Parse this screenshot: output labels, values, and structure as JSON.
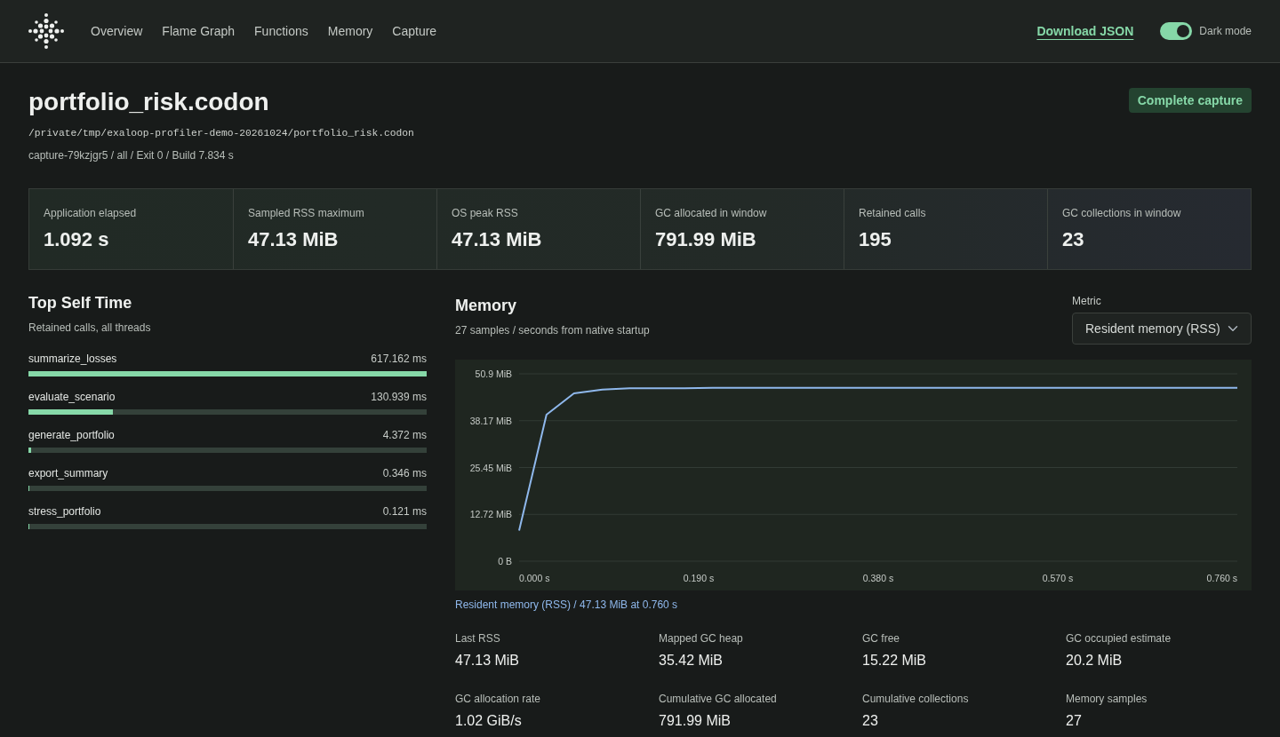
{
  "header": {
    "nav": [
      "Overview",
      "Flame Graph",
      "Functions",
      "Memory",
      "Capture"
    ],
    "download": "Download JSON",
    "dark_mode": {
      "label": "Dark mode",
      "on": true
    }
  },
  "page": {
    "title": "portfolio_risk.codon",
    "path": "/private/tmp/exaloop-profiler-demo-20261024/portfolio_risk.codon",
    "meta": "capture-79kzjgr5 / all / Exit 0 / Build 7.834 s",
    "status": "Complete capture"
  },
  "summary": [
    {
      "label": "Application elapsed",
      "value": "1.092 s"
    },
    {
      "label": "Sampled RSS maximum",
      "value": "47.13 MiB"
    },
    {
      "label": "OS peak RSS",
      "value": "47.13 MiB"
    },
    {
      "label": "GC allocated in window",
      "value": "791.99 MiB"
    },
    {
      "label": "Retained calls",
      "value": "195"
    },
    {
      "label": "GC collections in window",
      "value": "23"
    }
  ],
  "top_self_time": {
    "title": "Top Self Time",
    "subtitle": "Retained calls, all threads",
    "items": [
      {
        "name": "summarize_losses",
        "time": "617.162 ms",
        "level": 1
      },
      {
        "name": "evaluate_scenario",
        "time": "130.939 ms",
        "level": 0.212
      },
      {
        "name": "generate_portfolio",
        "time": "4.372 ms",
        "level": 0.007
      },
      {
        "name": "export_summary",
        "time": "0.346 ms",
        "level": 0.0006
      },
      {
        "name": "stress_portfolio",
        "time": "0.121 ms",
        "level": 0.0002
      }
    ]
  },
  "memory": {
    "title": "Memory",
    "subtitle": "27 samples / seconds from native startup",
    "metric": {
      "label": "Metric",
      "value": "Resident memory (RSS)"
    },
    "chart_data": {
      "type": "line",
      "grid": true,
      "x": [
        0,
        0.029,
        0.058,
        0.088,
        0.117,
        0.146,
        0.175,
        0.205,
        0.234,
        0.263,
        0.292,
        0.322,
        0.351,
        0.38,
        0.409,
        0.438,
        0.468,
        0.497,
        0.526,
        0.555,
        0.585,
        0.614,
        0.643,
        0.672,
        0.702,
        0.731,
        0.76
      ],
      "series": [
        {
          "color": "#8fb8ec",
          "values": [
            8.3,
            39.8,
            45.6,
            46.6,
            47.0,
            47.0,
            47.0,
            47.1,
            47.1,
            47.1,
            47.1,
            47.1,
            47.1,
            47.1,
            47.1,
            47.1,
            47.1,
            47.1,
            47.1,
            47.1,
            47.1,
            47.1,
            47.1,
            47.1,
            47.1,
            47.1,
            47.1
          ]
        }
      ],
      "xlim": [
        0,
        0.76
      ],
      "ylim": [
        0,
        50.9
      ],
      "xticks": [
        {
          "value": 0,
          "label": "0.000 s"
        },
        {
          "value": 0.19,
          "label": "0.190 s"
        },
        {
          "value": 0.38,
          "label": "0.380 s"
        },
        {
          "value": 0.57,
          "label": "0.570 s"
        },
        {
          "value": 0.76,
          "label": "0.760 s"
        }
      ],
      "yticks": [
        {
          "value": 0,
          "label": "0 B"
        },
        {
          "value": 12.72,
          "label": "12.72 MiB"
        },
        {
          "value": 25.45,
          "label": "25.45 MiB"
        },
        {
          "value": 38.17,
          "label": "38.17 MiB"
        },
        {
          "value": 50.9,
          "label": "50.9 MiB"
        }
      ]
    },
    "caption": "Resident memory (RSS) / 47.13 MiB at 0.760 s",
    "stats": [
      {
        "label": "Last RSS",
        "value": "47.13 MiB"
      },
      {
        "label": "Mapped GC heap",
        "value": "35.42 MiB"
      },
      {
        "label": "GC free",
        "value": "15.22 MiB"
      },
      {
        "label": "GC occupied estimate",
        "value": "20.2 MiB"
      },
      {
        "label": "GC allocation rate",
        "value": "1.02 GiB/s"
      },
      {
        "label": "Cumulative GC allocated",
        "value": "791.99 MiB"
      },
      {
        "label": "Cumulative collections",
        "value": "23"
      },
      {
        "label": "Memory samples",
        "value": "27"
      }
    ]
  }
}
